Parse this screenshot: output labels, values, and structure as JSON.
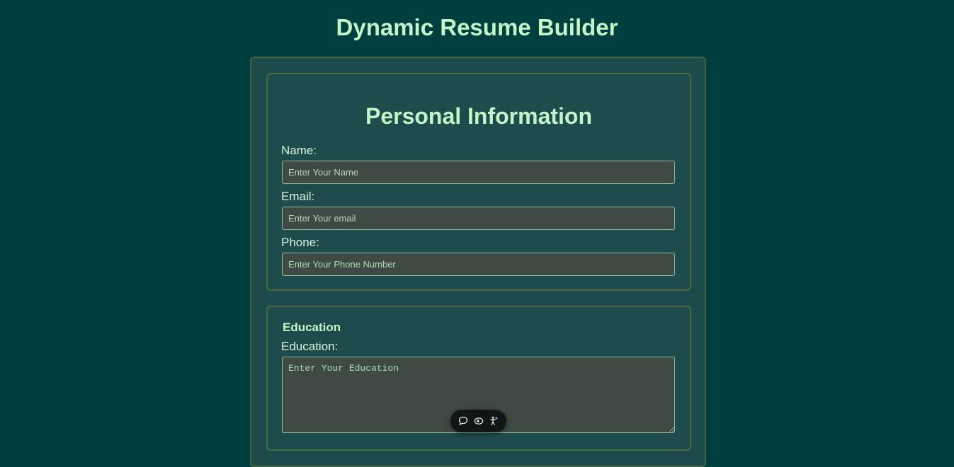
{
  "page": {
    "title": "Dynamic Resume Builder"
  },
  "personal": {
    "heading": "Personal Information",
    "name_label": "Name:",
    "name_placeholder": "Enter Your Name",
    "email_label": "Email:",
    "email_placeholder": "Enter Your email",
    "phone_label": "Phone:",
    "phone_placeholder": "Enter Your Phone Number"
  },
  "education": {
    "heading": "Education",
    "label": "Education:",
    "placeholder": "Enter Your Education"
  },
  "toolbar": {
    "icons": [
      "chat-bubble-icon",
      "eye-slash-icon",
      "accessibility-icon"
    ]
  },
  "colors": {
    "background": "#003f3f",
    "heading": "#c3f5c8",
    "panel_border": "#44633c",
    "input_bg": "#3f4a45",
    "input_border": "#8fbf9a"
  }
}
